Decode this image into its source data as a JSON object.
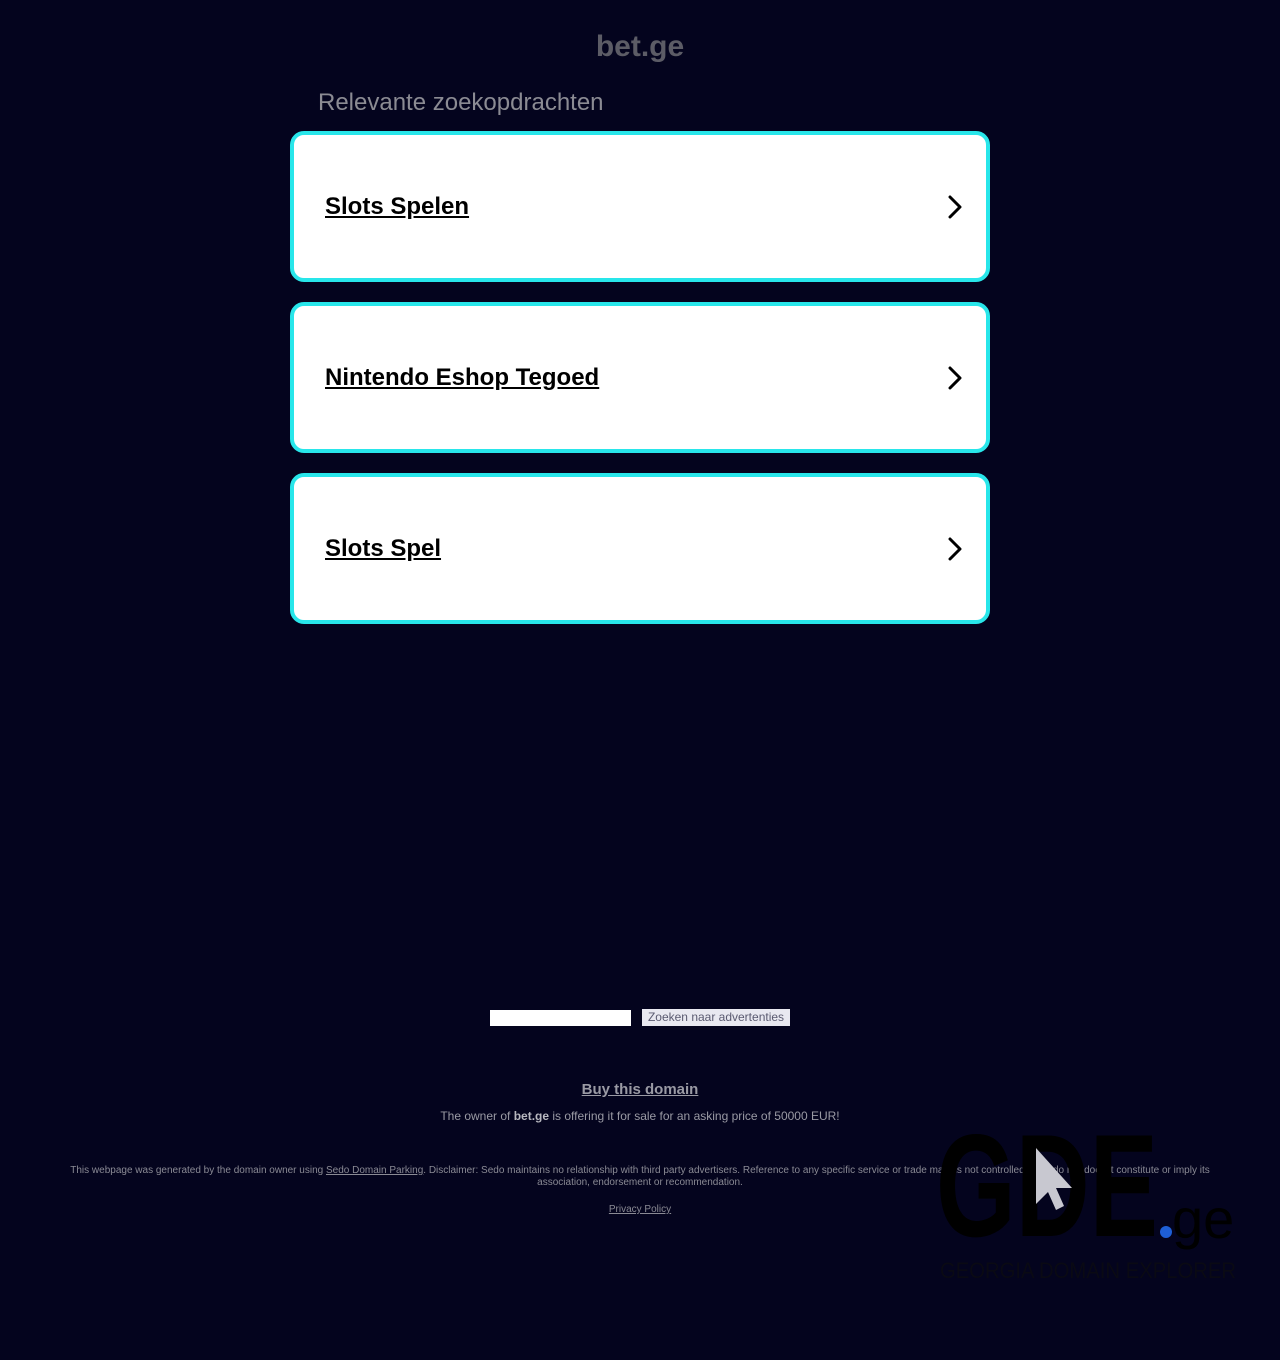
{
  "header": {
    "domain": "bet.ge",
    "related_heading": "Relevante zoekopdrachten"
  },
  "ads": [
    {
      "label": "Slots Spelen",
      "icon": "chevron-right-icon"
    },
    {
      "label": "Nintendo Eshop Tegoed",
      "icon": "chevron-right-icon"
    },
    {
      "label": "Slots Spel",
      "icon": "chevron-right-icon"
    }
  ],
  "search": {
    "input_value": "",
    "button_label": "Zoeken naar advertenties"
  },
  "footer": {
    "buy_link": "Buy this domain",
    "sale_prefix": "The owner of ",
    "sale_domain": "bet.ge",
    "sale_suffix": " is offering it for sale for an asking price of 50000 EUR!",
    "disclaimer_prefix": "This webpage was generated by the domain owner using ",
    "disclaimer_link": "Sedo Domain Parking",
    "disclaimer_suffix": ". Disclaimer: Sedo maintains no relationship with third party advertisers. Reference to any specific service or trade mark is not controlled by Sedo nor does it constitute or imply its association, endorsement or recommendation.",
    "privacy": "Privacy Policy"
  },
  "watermark": {
    "logo_text": "GDE",
    "tld": ".ge",
    "tagline": "GEORGIA DOMAIN EXPLORER"
  },
  "colors": {
    "background": "#04041e",
    "card_border": "#28e6ea",
    "logo_dot": "#1e5fd6"
  }
}
